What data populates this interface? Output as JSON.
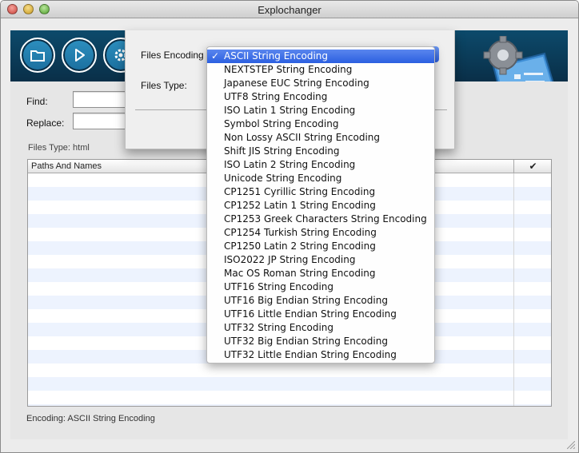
{
  "window": {
    "title": "Explochanger"
  },
  "toolbar": {
    "buttons": [
      {
        "icon": "folder-icon"
      },
      {
        "icon": "play-icon"
      },
      {
        "icon": "gear-icon"
      }
    ]
  },
  "form": {
    "find_label": "Find:",
    "find_value": "",
    "replace_label": "Replace:",
    "replace_value": "",
    "files_type_text": "Files Type:  html"
  },
  "table": {
    "columns": [
      "Paths And Names",
      "✔"
    ],
    "rows": []
  },
  "status": {
    "encoding_text": "Encoding:  ASCII String Encoding"
  },
  "sheet": {
    "files_encoding_label": "Files Encoding",
    "files_type_label": "Files Type:"
  },
  "encoding_menu": {
    "selected": "ASCII String Encoding",
    "items": [
      "ASCII String Encoding",
      "NEXTSTEP String Encoding",
      "Japanese EUC String Encoding",
      "UTF8 String Encoding",
      "ISO Latin 1 String Encoding",
      "Symbol String Encoding",
      "Non Lossy ASCII String Encoding",
      "Shift JIS String Encoding",
      "ISO Latin 2 String Encoding",
      "Unicode String Encoding",
      "CP1251 Cyrillic String Encoding",
      "CP1252 Latin 1 String Encoding",
      "CP1253 Greek Characters String Encoding",
      "CP1254 Turkish String Encoding",
      "CP1250 Latin 2 String Encoding",
      "ISO2022 JP String Encoding",
      "Mac OS Roman String Encoding",
      "UTF16 String Encoding",
      "UTF16 Big Endian String Encoding",
      "UTF16 Little Endian String Encoding",
      "UTF32 String Encoding",
      "UTF32 Big Endian String Encoding",
      "UTF32 Little Endian String Encoding"
    ]
  },
  "colors": {
    "toolbar": "#0c4a6b",
    "selection": "#2b5fe0",
    "row_stripe": "#edf3fe"
  }
}
